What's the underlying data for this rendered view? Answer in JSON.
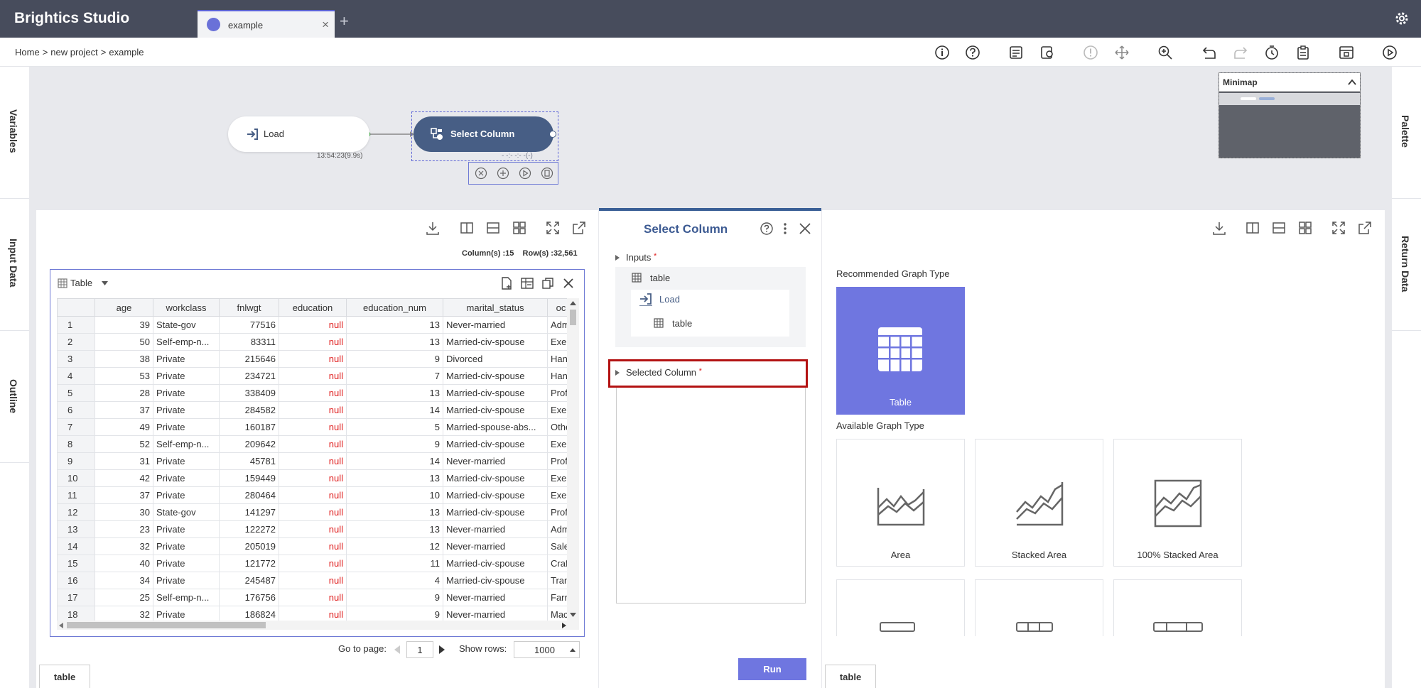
{
  "app": {
    "title": "Brightics Studio",
    "tab_label": "example",
    "tab_close": "×",
    "tab_add": "+"
  },
  "breadcrumb": [
    "Home",
    ">",
    "new project",
    ">",
    "example"
  ],
  "rails": {
    "left": [
      "Variables",
      "Input Data",
      "Outline"
    ],
    "right": [
      "Palette",
      "Return Data"
    ]
  },
  "flow": {
    "load_label": "Load",
    "load_time": "13:54:23(9.9s)",
    "select_label": "Select Column",
    "select_time": "- -:- -:- -(-)"
  },
  "minimap": {
    "title": "Minimap"
  },
  "left_panel": {
    "counts": "Column(s) :15    Row(s) :32,561",
    "table_title": "Table",
    "columns": [
      "",
      "age",
      "workclass",
      "fnlwgt",
      "education",
      "education_num",
      "marital_status",
      "oc"
    ],
    "rows": [
      [
        "1",
        "39",
        "State-gov",
        "77516",
        "null",
        "13",
        "Never-married",
        "Adm"
      ],
      [
        "2",
        "50",
        "Self-emp-n...",
        "83311",
        "null",
        "13",
        "Married-civ-spouse",
        "Exe"
      ],
      [
        "3",
        "38",
        "Private",
        "215646",
        "null",
        "9",
        "Divorced",
        "Han"
      ],
      [
        "4",
        "53",
        "Private",
        "234721",
        "null",
        "7",
        "Married-civ-spouse",
        "Han"
      ],
      [
        "5",
        "28",
        "Private",
        "338409",
        "null",
        "13",
        "Married-civ-spouse",
        "Prof"
      ],
      [
        "6",
        "37",
        "Private",
        "284582",
        "null",
        "14",
        "Married-civ-spouse",
        "Exe"
      ],
      [
        "7",
        "49",
        "Private",
        "160187",
        "null",
        "5",
        "Married-spouse-abs...",
        "Othe"
      ],
      [
        "8",
        "52",
        "Self-emp-n...",
        "209642",
        "null",
        "9",
        "Married-civ-spouse",
        "Exe"
      ],
      [
        "9",
        "31",
        "Private",
        "45781",
        "null",
        "14",
        "Never-married",
        "Prof"
      ],
      [
        "10",
        "42",
        "Private",
        "159449",
        "null",
        "13",
        "Married-civ-spouse",
        "Exe"
      ],
      [
        "11",
        "37",
        "Private",
        "280464",
        "null",
        "10",
        "Married-civ-spouse",
        "Exe"
      ],
      [
        "12",
        "30",
        "State-gov",
        "141297",
        "null",
        "13",
        "Married-civ-spouse",
        "Prof"
      ],
      [
        "13",
        "23",
        "Private",
        "122272",
        "null",
        "13",
        "Never-married",
        "Adm"
      ],
      [
        "14",
        "32",
        "Private",
        "205019",
        "null",
        "12",
        "Never-married",
        "Sale"
      ],
      [
        "15",
        "40",
        "Private",
        "121772",
        "null",
        "11",
        "Married-civ-spouse",
        "Craf"
      ],
      [
        "16",
        "34",
        "Private",
        "245487",
        "null",
        "4",
        "Married-civ-spouse",
        "Tran"
      ],
      [
        "17",
        "25",
        "Self-emp-n...",
        "176756",
        "null",
        "9",
        "Never-married",
        "Farr"
      ],
      [
        "18",
        "32",
        "Private",
        "186824",
        "null",
        "9",
        "Never-married",
        "Mac"
      ]
    ],
    "goto_label": "Go to page:",
    "page_value": "1",
    "show_rows_label": "Show rows:",
    "show_rows_value": "1000",
    "bottom_tab": "table"
  },
  "center_panel": {
    "title": "Select Column",
    "inputs_label": "Inputs",
    "required_mark": "*",
    "input_table": "table",
    "source_node": "Load",
    "source_table": "table",
    "selected_column_label": "Selected Column",
    "run_label": "Run"
  },
  "right_panel": {
    "recommended_label": "Recommended Graph Type",
    "recommended_graph": "Table",
    "available_label": "Available Graph Type",
    "graphs": [
      "Area",
      "Stacked Area",
      "100% Stacked Area"
    ],
    "bottom_tab": "table"
  },
  "colors": {
    "topbar": "#474c5c",
    "accent": "#6f76e0",
    "node_selected": "#475e85",
    "highlight": "#b31212",
    "null_text": "#e02020"
  }
}
